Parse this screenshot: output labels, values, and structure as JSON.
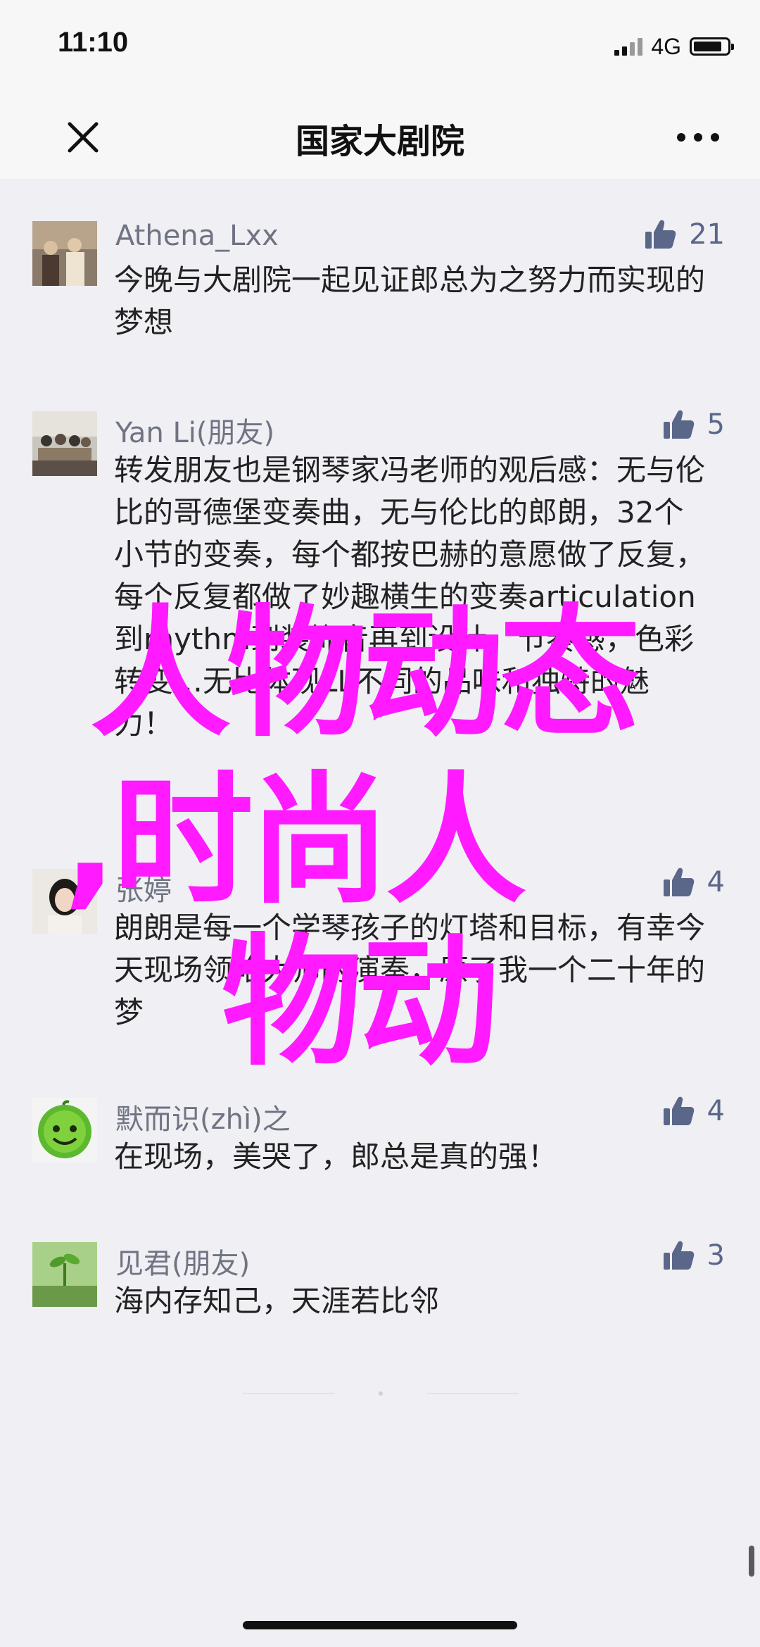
{
  "status_bar": {
    "time": "11:10",
    "network": "4G",
    "battery_level": 0.85
  },
  "nav": {
    "title": "国家大剧院",
    "close_icon": "close-icon",
    "more_icon": "more-icon"
  },
  "comments": [
    {
      "username": "Athena_Lxx",
      "likes": "21",
      "text": "今晚与大剧院一起见证郎总为之努力而实现的梦想"
    },
    {
      "username": "Yan Li(朋友)",
      "likes": "5",
      "text": "转发朋友也是钢琴家冯老师的观后感：无与伦比的哥德堡变奏曲，无与伦比的郎朗，32个小节的变奏，每个都按巴赫的意愿做了反复，每个反复都做了妙趣横生的变奏articulation到rhythm到装饰音再到设计，节奏感，色彩转变…无比体现LL不同的品味和独特的魅力！"
    },
    {
      "username": "张婷",
      "likes": "4",
      "text": "朗朗是每一个学琴孩子的灯塔和目标，有幸今天现场领略大师的演奏，原了我一个二十年的梦"
    },
    {
      "username": "默而识(zhì)之",
      "likes": "4",
      "text": "在现场，美哭了，郎总是真的强！"
    },
    {
      "username": "见君(朋友)",
      "likes": "3",
      "text": "海内存知己，天涯若比邻"
    }
  ],
  "watermark": {
    "line1": "人物动态",
    "line2": ",时尚人",
    "line3": "物动"
  },
  "colors": {
    "accent_like": "#5a6789",
    "username": "#6f7382",
    "watermark": "#ff1aff",
    "background": "#efeff4"
  }
}
